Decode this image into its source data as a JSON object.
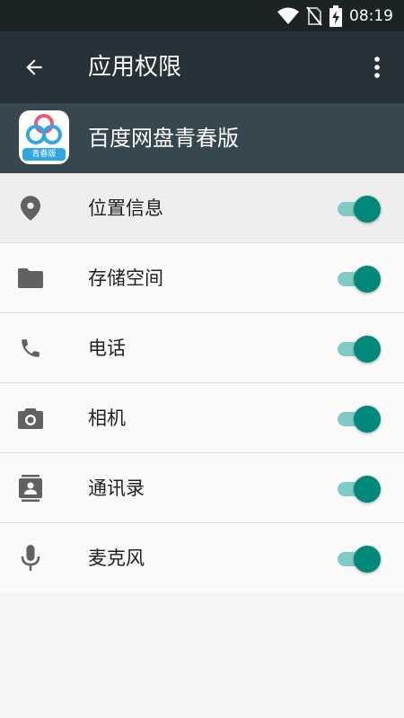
{
  "status_bar": {
    "time": "08:19",
    "icons": [
      "wifi-icon",
      "no-sim-icon",
      "battery-charging-icon"
    ]
  },
  "app_bar": {
    "title": "应用权限",
    "back_icon": "back-arrow-icon",
    "more_icon": "more-vert-icon",
    "background": "#263238"
  },
  "app_header": {
    "app_name": "百度网盘青春版",
    "icon_badge": "青春版",
    "background": "#37474f"
  },
  "permissions": [
    {
      "label": "位置信息",
      "icon": "location-icon",
      "enabled": true
    },
    {
      "label": "存储空间",
      "icon": "folder-icon",
      "enabled": true
    },
    {
      "label": "电话",
      "icon": "phone-icon",
      "enabled": true
    },
    {
      "label": "相机",
      "icon": "camera-icon",
      "enabled": true
    },
    {
      "label": "通讯录",
      "icon": "contacts-icon",
      "enabled": true
    },
    {
      "label": "麦克风",
      "icon": "microphone-icon",
      "enabled": true
    }
  ],
  "colors": {
    "toggle_on_thumb": "#00897b",
    "toggle_on_track": "#80cbc4",
    "icon_gray": "#616161"
  }
}
